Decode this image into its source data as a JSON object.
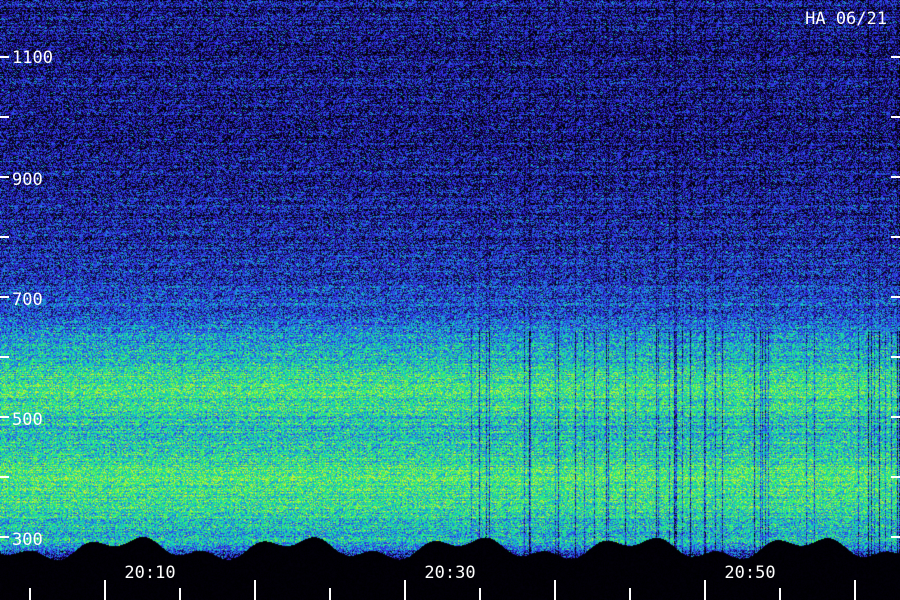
{
  "chart_data": {
    "type": "heatmap",
    "title": "HA 06/21",
    "xlabel": "",
    "ylabel": "",
    "x_tick_labels": [
      "20:10",
      "20:30",
      "20:50"
    ],
    "y_tick_labels": [
      "1100",
      "900",
      "700",
      "500",
      "300"
    ],
    "y_ticks": [
      1100,
      1000,
      900,
      800,
      700,
      600,
      500,
      400,
      300
    ],
    "ylim": [
      250,
      1230
    ],
    "x_range": [
      "20:03",
      "21:03"
    ],
    "x_minor_step_minutes": 5,
    "grid": false,
    "colormap": [
      "#000000",
      "#140a5a",
      "#3422e8",
      "#2a5ae6",
      "#16b0d8",
      "#1ae6a0",
      "#3cf25a",
      "#c8f032"
    ],
    "intensity_profile": [
      {
        "y": 1200,
        "level": 0.18
      },
      {
        "y": 1100,
        "level": 0.17
      },
      {
        "y": 1000,
        "level": 0.18
      },
      {
        "y": 900,
        "level": 0.2
      },
      {
        "y": 800,
        "level": 0.24
      },
      {
        "y": 750,
        "level": 0.28
      },
      {
        "y": 700,
        "level": 0.34
      },
      {
        "y": 650,
        "level": 0.44
      },
      {
        "y": 610,
        "level": 0.58
      },
      {
        "y": 570,
        "level": 0.74
      },
      {
        "y": 540,
        "level": 0.78
      },
      {
        "y": 500,
        "level": 0.66
      },
      {
        "y": 460,
        "level": 0.64
      },
      {
        "y": 400,
        "level": 0.8
      },
      {
        "y": 360,
        "level": 0.76
      },
      {
        "y": 320,
        "level": 0.64
      },
      {
        "y": 290,
        "level": 0.58
      },
      {
        "y": 260,
        "level": 0.05
      }
    ]
  }
}
